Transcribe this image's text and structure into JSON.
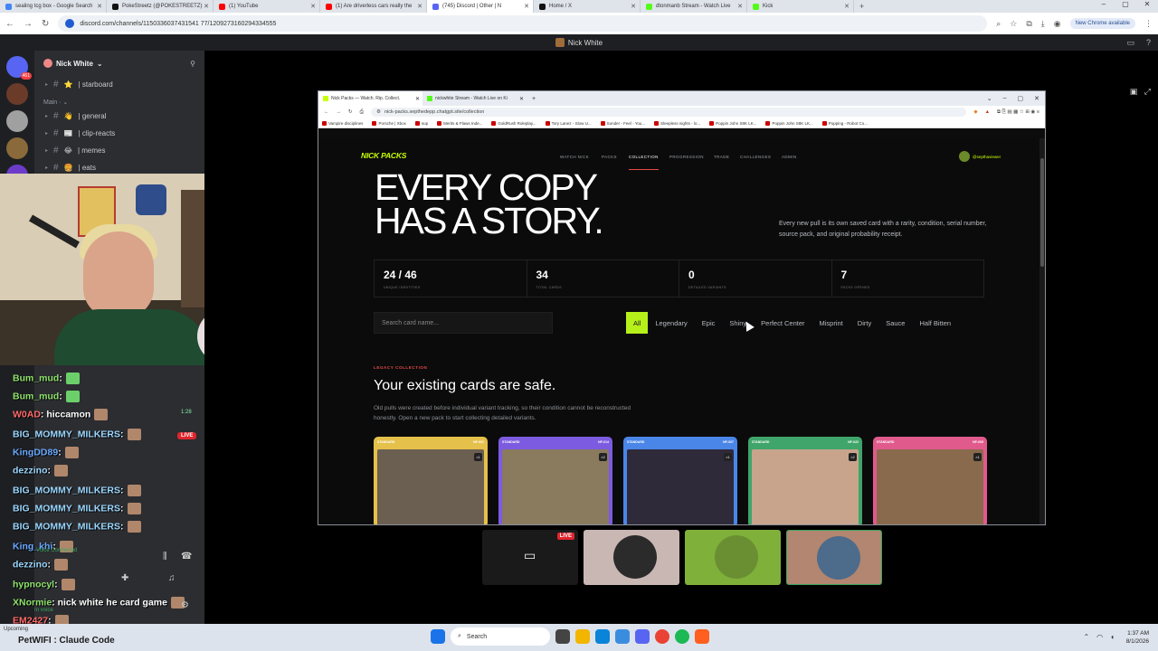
{
  "browser": {
    "tabs": [
      {
        "title": "sealing tcg box - Google Search",
        "color": "#4285f4"
      },
      {
        "title": "PokeStreetz (@POKESTREETZ)",
        "color": "#111111"
      },
      {
        "title": "(1) YouTube",
        "color": "#ff0000"
      },
      {
        "title": "(1) Are driverless cars really the",
        "color": "#ff0000"
      },
      {
        "title": "(745) Discord | Other | N",
        "color": "#5865f2",
        "active": true
      },
      {
        "title": "Home / X",
        "color": "#111111"
      },
      {
        "title": "dtonmanb Stream - Watch Live",
        "color": "#53fc18"
      },
      {
        "title": "Kick",
        "color": "#53fc18"
      }
    ],
    "url": "discord.com/channels/1150336037431541 77/1209273160294334555",
    "update_label": "New Chrome available"
  },
  "discord": {
    "top_title": "Nick White",
    "rail_badge": "461",
    "server_name": "Nick White",
    "channels_top": [
      {
        "emoji": "⭐",
        "name": "| starboard"
      }
    ],
    "category": "Main",
    "channels": [
      {
        "emoji": "👋",
        "name": "| general"
      },
      {
        "emoji": "📰",
        "name": "| clip-reacts"
      },
      {
        "emoji": "😂",
        "name": "| memes"
      },
      {
        "emoji": "🍔",
        "name": "| eats"
      }
    ],
    "chat": [
      {
        "user": "Bum_mud",
        "msg": ":",
        "color": "green"
      },
      {
        "user": "Bum_mud",
        "msg": ":",
        "color": "green"
      },
      {
        "user": "W0AD",
        "msg": ": hiccamon",
        "color": "red"
      },
      {
        "user": "BIG_MOMMY_MILKERS",
        "msg": ":",
        "color": "cyan"
      },
      {
        "user": "KingDD89",
        "msg": ":",
        "color": "blue"
      },
      {
        "user": "dezzino",
        "msg": ":",
        "color": "cyan"
      },
      {
        "user": "BIG_MOMMY_MILKERS",
        "msg": ":",
        "color": "cyan"
      },
      {
        "user": "BIG_MOMMY_MILKERS",
        "msg": ":",
        "color": "cyan"
      },
      {
        "user": "BIG_MOMMY_MILKERS",
        "msg": ":",
        "color": "cyan"
      },
      {
        "user": "King_khi",
        "msg": ":",
        "color": "blue"
      },
      {
        "user": "dezzino",
        "msg": ":",
        "color": "cyan"
      },
      {
        "user": "hypnocyl",
        "msg": ":",
        "color": "green"
      },
      {
        "user": "XNormie",
        "msg": ": nick white he card game",
        "color": "green"
      },
      {
        "user": "EM2427",
        "msg": ":",
        "color": "red"
      },
      {
        "user": "PetWIFI",
        "msg": ": Claude Code",
        "color": "green"
      }
    ],
    "chat_time": "1:28",
    "live": "LIVE",
    "voice_status": "Voice Connected",
    "in_voice": "In voice",
    "upcoming": "Upcoming"
  },
  "inner_browser": {
    "tabs": [
      {
        "title": "Nick Packs — Watch. Rip. Collect.",
        "color": "#c8ff00",
        "active": true
      },
      {
        "title": "nickwhite Stream - Watch Live on Ki",
        "color": "#53fc18"
      }
    ],
    "url": "nick-packs.septhedepp.chatgpt.site/collection",
    "bookmarks": [
      "Vampire disciplines",
      "Porsche | Xbox",
      "sup",
      "Merits & Flaws Inde...",
      "GoldRush Roleplay...",
      "Tory Lanez - Slow U...",
      "Sonder - Feel - You...",
      "Sleepless nights - lo...",
      "Poppin John S8K LK...",
      "Poppin John S8K LK...",
      "Popping - Robot Co..."
    ]
  },
  "site": {
    "logo": "NICK PACKS",
    "nav": [
      "WATCH NICK",
      "PACKS",
      "COLLECTION",
      "PROGRESSION",
      "TRADE",
      "CHALLENGES",
      "ADMIN"
    ],
    "active_nav": "COLLECTION",
    "user": "@septhaviewer",
    "hero_title": "EVERY COPY HAS A STORY.",
    "hero_sub": "Every new pull is its own saved card with a rarity, condition, serial number, source pack, and original probability receipt.",
    "stats": [
      {
        "value": "24 / 46",
        "label": "UNIQUE IDENTITIES"
      },
      {
        "value": "34",
        "label": "TOTAL CARDS"
      },
      {
        "value": "0",
        "label": "DETAILED VARIANTS"
      },
      {
        "value": "7",
        "label": "PACKS OPENED"
      }
    ],
    "search_placeholder": "Search card name...",
    "filters": [
      "All",
      "Legendary",
      "Epic",
      "Shiny",
      "Perfect Center",
      "Misprint",
      "Dirty",
      "Sauce",
      "Half Bitten"
    ],
    "active_filter": "All",
    "legacy_label": "LEGACY COLLECTION",
    "legacy_title": "Your existing cards are safe.",
    "legacy_desc": "Old pulls were created before individual variant tracking, so their condition cannot be reconstructed honestly. Open a new pack to start collecting detailed variants.",
    "cards": [
      {
        "tag": "STANDARD",
        "num": "NP-001",
        "count": "×1",
        "color": "#e5c04a",
        "img": "#6b5f52"
      },
      {
        "tag": "STANDARD",
        "num": "NP-014",
        "count": "×2",
        "color": "#7c5be0",
        "img": "#8a7a5e"
      },
      {
        "tag": "STANDARD",
        "num": "NP-007",
        "count": "×1",
        "color": "#4a86e8",
        "img": "#2e2a3a"
      },
      {
        "tag": "STANDARD",
        "num": "NP-022",
        "count": "×2",
        "color": "#3fa56a",
        "img": "#c9a48c"
      },
      {
        "tag": "STANDARD",
        "num": "NP-005",
        "count": "×1",
        "color": "#e05a8c",
        "img": "#8a6a4c"
      }
    ]
  },
  "participants": [
    {
      "name": "screen-share",
      "live": "LIVE",
      "bg": "#1a1a1a"
    },
    {
      "name": "marvel-avatar",
      "bg": "#c9b7b4",
      "circle": "#2b2b2b"
    },
    {
      "name": "bird-avatar",
      "bg": "#7fb03a",
      "circle": "#6a8f33"
    },
    {
      "name": "selfie-avatar",
      "bg": "#b28670",
      "circle": "#4d6b8a"
    }
  ],
  "taskbar": {
    "search": "Search",
    "clock_time": "1:37 AM",
    "clock_date": "8/1/2026",
    "left_title": "Upcoming",
    "left_sub": "PetWIFI : Claude Code"
  }
}
